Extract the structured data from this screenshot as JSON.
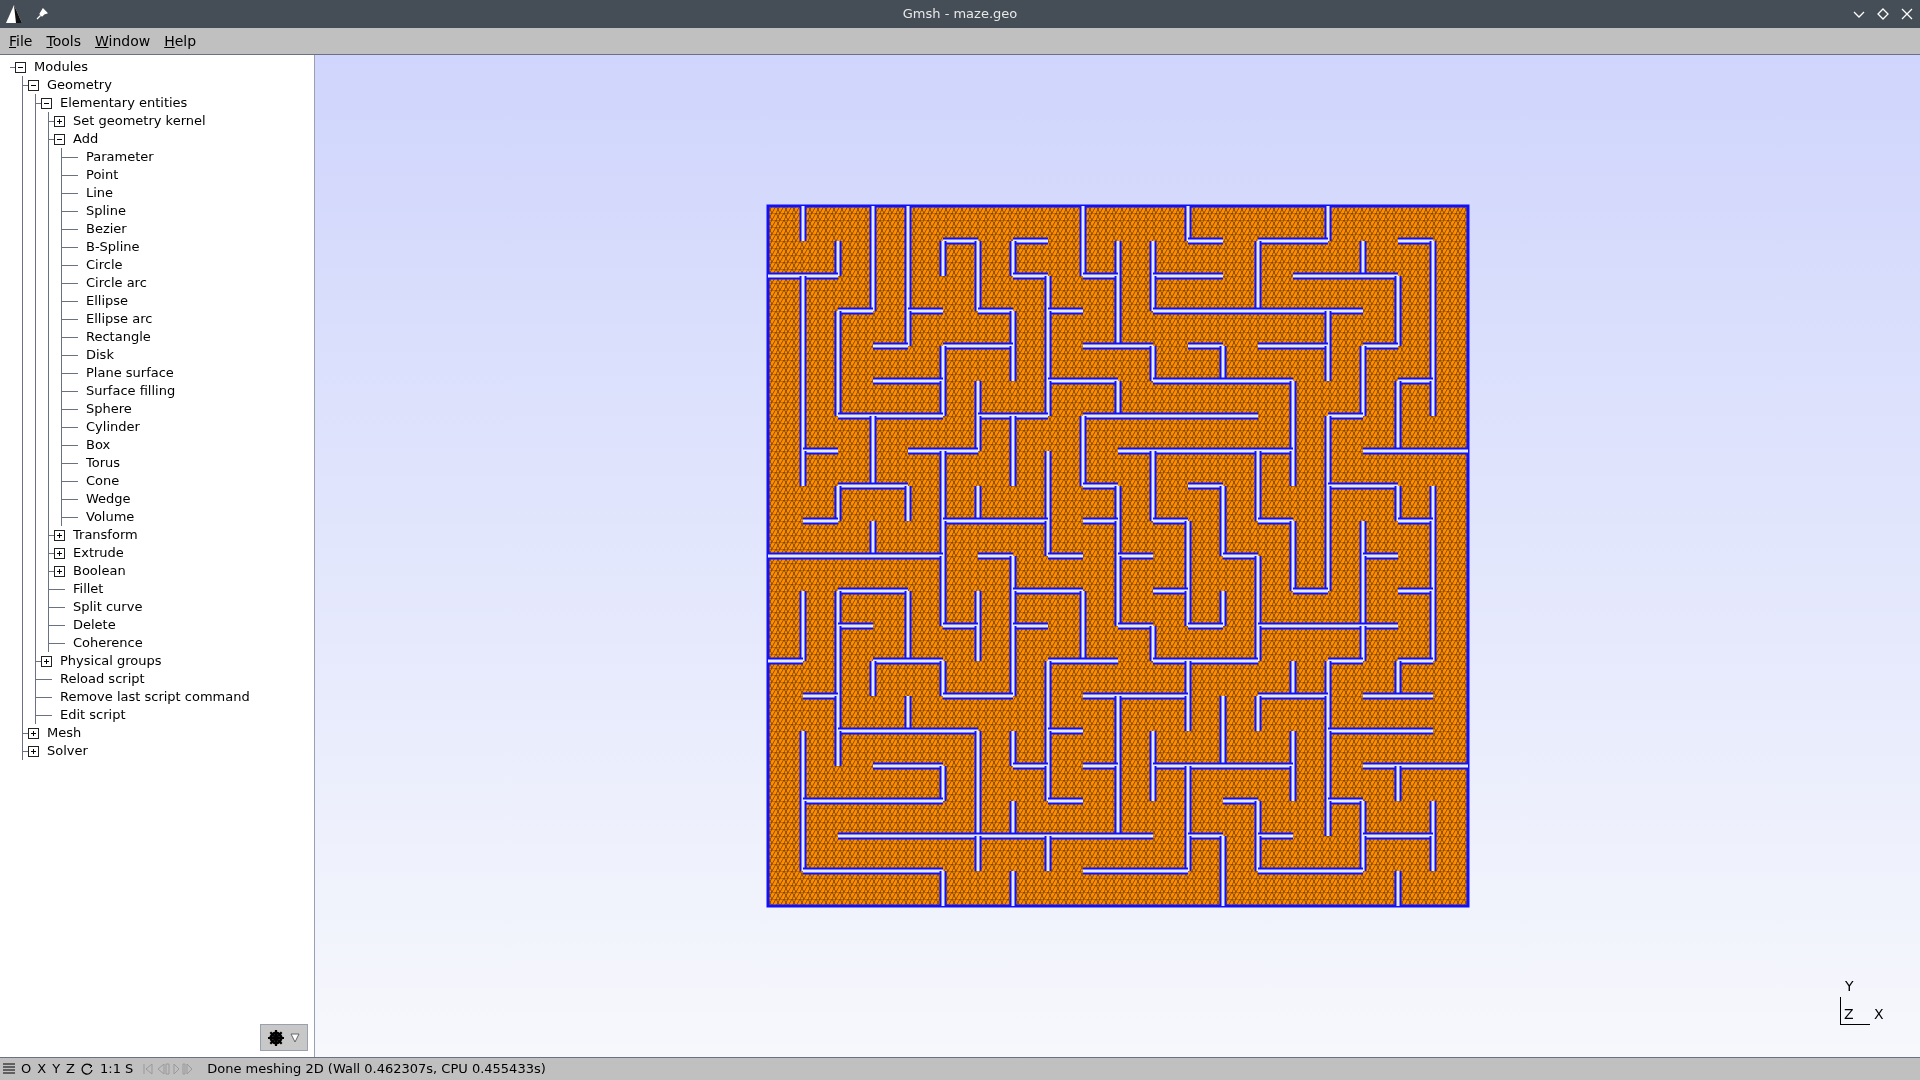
{
  "window": {
    "title": "Gmsh - maze.geo"
  },
  "menu": [
    "File",
    "Tools",
    "Window",
    "Help"
  ],
  "tree": [
    {
      "label": "Modules",
      "expanded": true,
      "children": [
        {
          "label": "Geometry",
          "expanded": true,
          "children": [
            {
              "label": "Elementary entities",
              "expanded": true,
              "children": [
                {
                  "label": "Set geometry kernel",
                  "expanded": false
                },
                {
                  "label": "Add",
                  "expanded": true,
                  "children": [
                    {
                      "label": "Parameter"
                    },
                    {
                      "label": "Point"
                    },
                    {
                      "label": "Line"
                    },
                    {
                      "label": "Spline"
                    },
                    {
                      "label": "Bezier"
                    },
                    {
                      "label": "B-Spline"
                    },
                    {
                      "label": "Circle"
                    },
                    {
                      "label": "Circle arc"
                    },
                    {
                      "label": "Ellipse"
                    },
                    {
                      "label": "Ellipse arc"
                    },
                    {
                      "label": "Rectangle"
                    },
                    {
                      "label": "Disk"
                    },
                    {
                      "label": "Plane surface"
                    },
                    {
                      "label": "Surface filling"
                    },
                    {
                      "label": "Sphere"
                    },
                    {
                      "label": "Cylinder"
                    },
                    {
                      "label": "Box"
                    },
                    {
                      "label": "Torus"
                    },
                    {
                      "label": "Cone"
                    },
                    {
                      "label": "Wedge"
                    },
                    {
                      "label": "Volume"
                    }
                  ]
                },
                {
                  "label": "Transform",
                  "expanded": false
                },
                {
                  "label": "Extrude",
                  "expanded": false
                },
                {
                  "label": "Boolean",
                  "expanded": false
                },
                {
                  "label": "Fillet"
                },
                {
                  "label": "Split curve"
                },
                {
                  "label": "Delete"
                },
                {
                  "label": "Coherence"
                }
              ]
            },
            {
              "label": "Physical groups",
              "expanded": false
            },
            {
              "label": "Reload script"
            },
            {
              "label": "Remove last script command"
            },
            {
              "label": "Edit script"
            }
          ]
        },
        {
          "label": "Mesh",
          "expanded": false
        },
        {
          "label": "Solver",
          "expanded": false
        }
      ]
    }
  ],
  "axes": {
    "y": "Y",
    "z": "Z",
    "x": "X"
  },
  "status_bar": {
    "buttons": [
      "O",
      "X",
      "Y",
      "Z"
    ],
    "scale": "1:1",
    "s": "S",
    "message": "Done meshing 2D (Wall 0.462307s, CPU 0.455433s)"
  }
}
